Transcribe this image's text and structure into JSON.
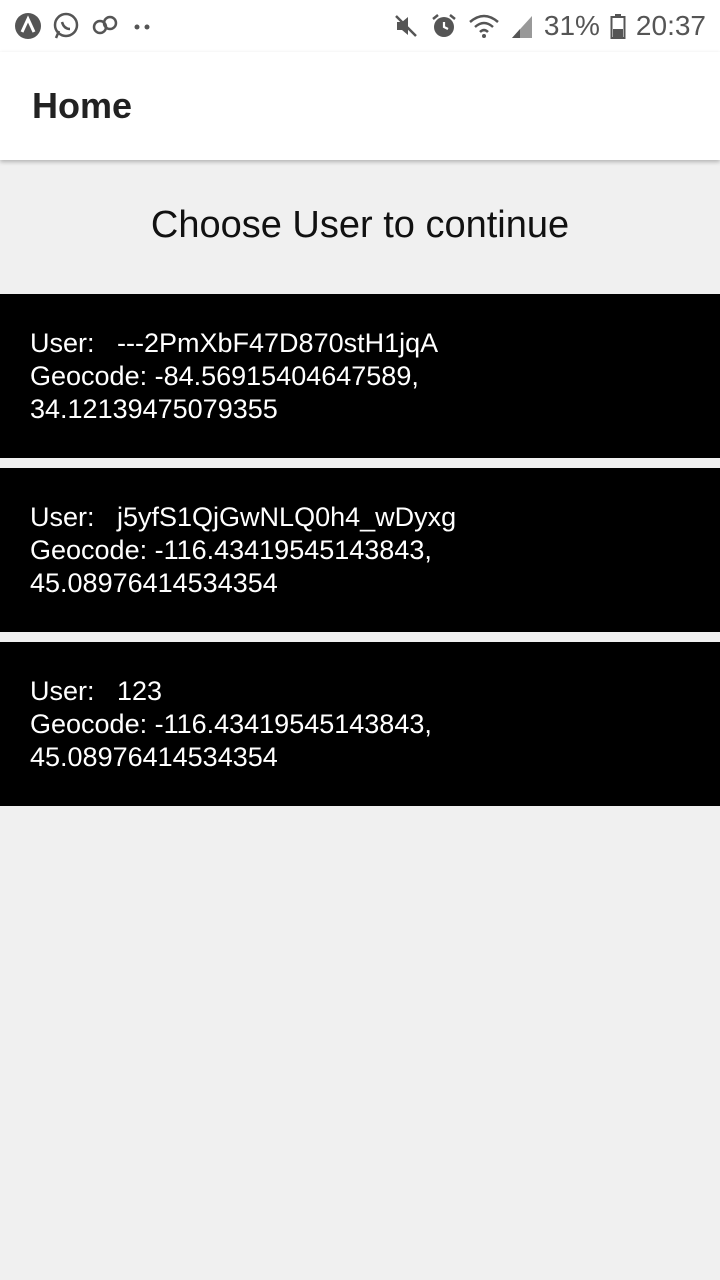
{
  "status_bar": {
    "battery": "31%",
    "time": "20:37"
  },
  "app_bar": {
    "title": "Home"
  },
  "prompt": "Choose User to continue",
  "users": [
    {
      "user_line": "User:   ---2PmXbF47D870stH1jqA",
      "geocode_line": "Geocode: -84.56915404647589,",
      "geocode_cont": "34.12139475079355"
    },
    {
      "user_line": "User:   j5yfS1QjGwNLQ0h4_wDyxg",
      "geocode_line": "Geocode: -116.43419545143843,",
      "geocode_cont": "45.08976414534354"
    },
    {
      "user_line": "User:   123",
      "geocode_line": "Geocode: -116.43419545143843,",
      "geocode_cont": "45.08976414534354"
    }
  ]
}
